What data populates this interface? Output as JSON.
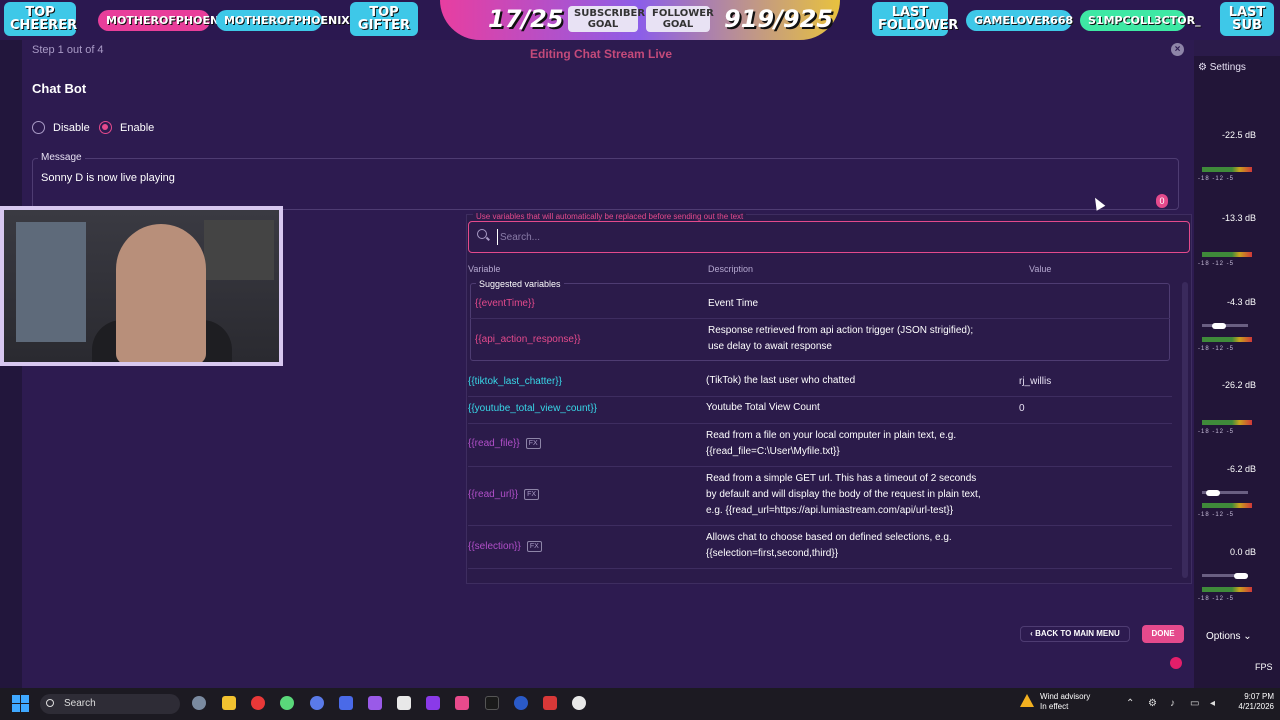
{
  "overlay": {
    "top_cheerer": "TOP CHEERER",
    "cheerer_name": "MOTHEROFPHOENIXES",
    "gifter_name": "MOTHEROFPHOENIXES",
    "top_gifter": "TOP GIFTER",
    "sub_count": "17/25",
    "subscriber_goal": "SUBSCRIBER GOAL",
    "follower_goal": "FOLLOWER GOAL",
    "follower_count": "919/925",
    "last_follower": "LAST FOLLOWER",
    "follower_name": "GAMELOVER668",
    "sub_name": "S1MPCOLL3CTOR_",
    "last_sub": "LAST SUB"
  },
  "modal": {
    "step": "Step 1 out of 4",
    "title_partial": "Editing Chat Stream Live",
    "section": "Chat Bot",
    "disable_label": "Disable",
    "enable_label": "Enable",
    "enabled": true,
    "message_label": "Message",
    "message_value": "Sonny D is now live playing",
    "count_badge": "0"
  },
  "variables": {
    "legend": "Use variables that will automatically be replaced before sending out the text",
    "search_placeholder": "Search...",
    "col_variable": "Variable",
    "col_description": "Description",
    "col_value": "Value",
    "suggested_label": "Suggested variables",
    "suggested": [
      {
        "name": "{{eventTime}}",
        "desc": "Event Time"
      },
      {
        "name": "{{api_action_response}}",
        "desc": "Response retrieved from api action trigger (JSON strigified);",
        "desc2": "use delay to await response"
      }
    ],
    "rows": [
      {
        "name": "{{tiktok_last_chatter}}",
        "desc": "(TikTok) the last user who chatted",
        "value": "rj_willis"
      },
      {
        "name": "{{youtube_total_view_count}}",
        "desc": "Youtube Total View Count",
        "value": "0"
      },
      {
        "name": "{{read_file}}",
        "fx": "FX",
        "desc": "Read from a file on your local computer in plain text, e.g.",
        "desc2": "{{read_file=C:\\User\\Myfile.txt}}"
      },
      {
        "name": "{{read_url}}",
        "fx": "FX",
        "desc": "Read from a simple GET url. This has a timeout of 2 seconds",
        "desc2": "by default and will display the body of the request in plain text,",
        "desc3": "e.g. {{read_url=https://api.lumiastream.com/api/url-test}}"
      },
      {
        "name": "{{selection}}",
        "fx": "FX",
        "desc": "Allows chat to choose based on defined selections, e.g.",
        "desc2": "{{selection=first,second,third}}"
      }
    ]
  },
  "footer": {
    "back_label": "BACK TO MAIN MENU",
    "done_label": "DONE"
  },
  "mixer": {
    "settings": "Settings",
    "levels": [
      "-22.5 dB",
      "-13.3 dB",
      "-4.3 dB",
      "-26.2 dB",
      "-6.2 dB",
      "0.0 dB"
    ],
    "ticks": "-18 -12 -5",
    "options": "Options",
    "fps": "FPS"
  },
  "taskbar": {
    "search": "Search",
    "weather_title": "Wind advisory",
    "weather_sub": "In effect",
    "time": "9:07 PM",
    "date": "4/21/2026"
  },
  "colors": {
    "accent": "#e44a8c",
    "cyan_var": "#38d8e8",
    "background": "#2d1b50"
  }
}
